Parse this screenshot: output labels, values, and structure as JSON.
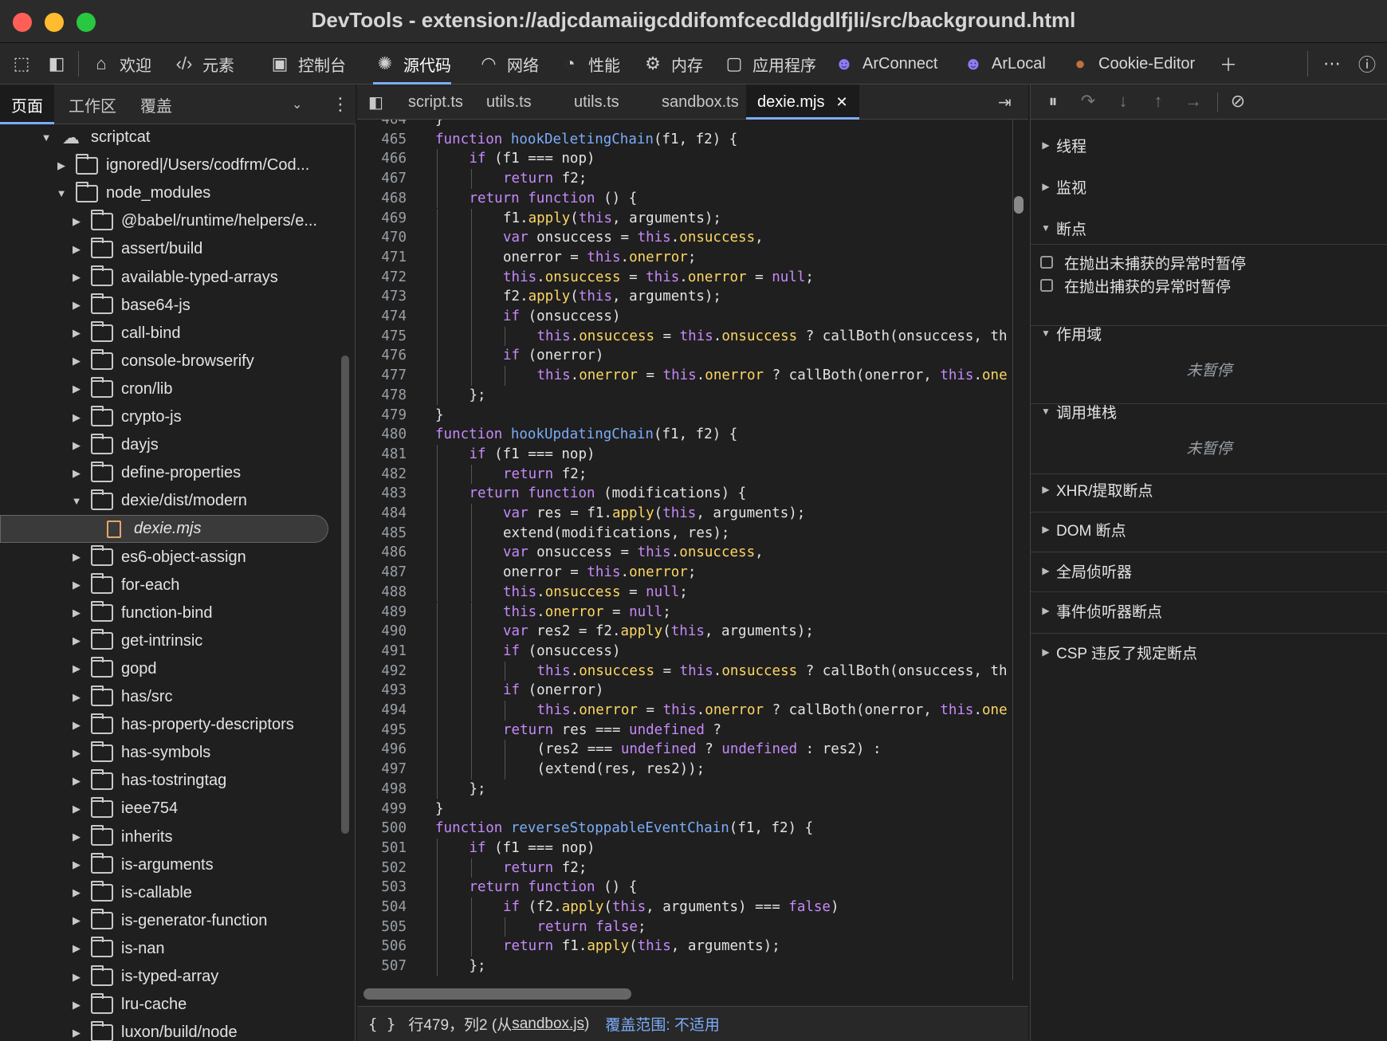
{
  "window": {
    "title": "DevTools - extension://adjcdamaiigcddifomfcecdldgdlfjli/src/background.html"
  },
  "main_tabs": [
    {
      "label": "欢迎",
      "icon": "home-icon"
    },
    {
      "label": "元素",
      "icon": "code-icon"
    },
    {
      "label": "控制台",
      "icon": "console-icon"
    },
    {
      "label": "源代码",
      "icon": "sources-bug-icon"
    },
    {
      "label": "网络",
      "icon": "wifi-icon"
    },
    {
      "label": "性能",
      "icon": "performance-icon"
    },
    {
      "label": "内存",
      "icon": "memory-chip-icon"
    },
    {
      "label": "应用程序",
      "icon": "application-icon"
    },
    {
      "label": "ArConnect",
      "icon": "arconnect-icon"
    },
    {
      "label": "ArLocal",
      "icon": "arlocal-icon"
    },
    {
      "label": "Cookie-Editor",
      "icon": "cookie-icon"
    }
  ],
  "navigator": {
    "tabs": [
      "页面",
      "工作区",
      "覆盖"
    ],
    "tree": [
      {
        "label": "scriptcat",
        "kind": "cloud",
        "depth": 0,
        "expanded": true
      },
      {
        "label": "ignored|/Users/codfrm/Cod...",
        "kind": "folder",
        "depth": 1,
        "expanded": false
      },
      {
        "label": "node_modules",
        "kind": "folder",
        "depth": 1,
        "expanded": true
      },
      {
        "label": "@babel/runtime/helpers/e...",
        "kind": "folder",
        "depth": 2,
        "expanded": false
      },
      {
        "label": "assert/build",
        "kind": "folder",
        "depth": 2,
        "expanded": false
      },
      {
        "label": "available-typed-arrays",
        "kind": "folder",
        "depth": 2,
        "expanded": false
      },
      {
        "label": "base64-js",
        "kind": "folder",
        "depth": 2,
        "expanded": false
      },
      {
        "label": "call-bind",
        "kind": "folder",
        "depth": 2,
        "expanded": false
      },
      {
        "label": "console-browserify",
        "kind": "folder",
        "depth": 2,
        "expanded": false
      },
      {
        "label": "cron/lib",
        "kind": "folder",
        "depth": 2,
        "expanded": false
      },
      {
        "label": "crypto-js",
        "kind": "folder",
        "depth": 2,
        "expanded": false
      },
      {
        "label": "dayjs",
        "kind": "folder",
        "depth": 2,
        "expanded": false
      },
      {
        "label": "define-properties",
        "kind": "folder",
        "depth": 2,
        "expanded": false
      },
      {
        "label": "dexie/dist/modern",
        "kind": "folder",
        "depth": 2,
        "expanded": true
      },
      {
        "label": "dexie.mjs",
        "kind": "file",
        "depth": 3,
        "selected": true
      },
      {
        "label": "es6-object-assign",
        "kind": "folder",
        "depth": 2,
        "expanded": false
      },
      {
        "label": "for-each",
        "kind": "folder",
        "depth": 2,
        "expanded": false
      },
      {
        "label": "function-bind",
        "kind": "folder",
        "depth": 2,
        "expanded": false
      },
      {
        "label": "get-intrinsic",
        "kind": "folder",
        "depth": 2,
        "expanded": false
      },
      {
        "label": "gopd",
        "kind": "folder",
        "depth": 2,
        "expanded": false
      },
      {
        "label": "has/src",
        "kind": "folder",
        "depth": 2,
        "expanded": false
      },
      {
        "label": "has-property-descriptors",
        "kind": "folder",
        "depth": 2,
        "expanded": false
      },
      {
        "label": "has-symbols",
        "kind": "folder",
        "depth": 2,
        "expanded": false
      },
      {
        "label": "has-tostringtag",
        "kind": "folder",
        "depth": 2,
        "expanded": false
      },
      {
        "label": "ieee754",
        "kind": "folder",
        "depth": 2,
        "expanded": false
      },
      {
        "label": "inherits",
        "kind": "folder",
        "depth": 2,
        "expanded": false
      },
      {
        "label": "is-arguments",
        "kind": "folder",
        "depth": 2,
        "expanded": false
      },
      {
        "label": "is-callable",
        "kind": "folder",
        "depth": 2,
        "expanded": false
      },
      {
        "label": "is-generator-function",
        "kind": "folder",
        "depth": 2,
        "expanded": false
      },
      {
        "label": "is-nan",
        "kind": "folder",
        "depth": 2,
        "expanded": false
      },
      {
        "label": "is-typed-array",
        "kind": "folder",
        "depth": 2,
        "expanded": false
      },
      {
        "label": "lru-cache",
        "kind": "folder",
        "depth": 2,
        "expanded": false
      },
      {
        "label": "luxon/build/node",
        "kind": "folder",
        "depth": 2,
        "expanded": false
      }
    ]
  },
  "editor": {
    "tabs": [
      {
        "label": "script.ts",
        "active": false
      },
      {
        "label": "utils.ts",
        "active": false
      },
      {
        "label": "utils.ts",
        "active": false
      },
      {
        "label": "sandbox.ts",
        "active": false
      },
      {
        "label": "dexie.mjs",
        "active": true
      }
    ],
    "lines": [
      {
        "n": "464",
        "t": "}",
        "i": 0
      },
      {
        "n": "465",
        "t": "function hookDeletingChain(f1, f2) {",
        "i": 0
      },
      {
        "n": "466",
        "t": "if (f1 === nop)",
        "i": 1
      },
      {
        "n": "467",
        "t": "return f2;",
        "i": 2
      },
      {
        "n": "468",
        "t": "return function () {",
        "i": 1
      },
      {
        "n": "469",
        "t": "f1.apply(this, arguments);",
        "i": 2
      },
      {
        "n": "470",
        "t": "var onsuccess = this.onsuccess,",
        "i": 2
      },
      {
        "n": "471",
        "t": "onerror = this.onerror;",
        "i": 2
      },
      {
        "n": "472",
        "t": "this.onsuccess = this.onerror = null;",
        "i": 2
      },
      {
        "n": "473",
        "t": "f2.apply(this, arguments);",
        "i": 2
      },
      {
        "n": "474",
        "t": "if (onsuccess)",
        "i": 2
      },
      {
        "n": "475",
        "t": "this.onsuccess = this.onsuccess ? callBoth(onsuccess, th",
        "i": 3
      },
      {
        "n": "476",
        "t": "if (onerror)",
        "i": 2
      },
      {
        "n": "477",
        "t": "this.onerror = this.onerror ? callBoth(onerror, this.one",
        "i": 3
      },
      {
        "n": "478",
        "t": "};",
        "i": 1
      },
      {
        "n": "479",
        "t": "}",
        "i": 0
      },
      {
        "n": "480",
        "t": "function hookUpdatingChain(f1, f2) {",
        "i": 0
      },
      {
        "n": "481",
        "t": "if (f1 === nop)",
        "i": 1
      },
      {
        "n": "482",
        "t": "return f2;",
        "i": 2
      },
      {
        "n": "483",
        "t": "return function (modifications) {",
        "i": 1
      },
      {
        "n": "484",
        "t": "var res = f1.apply(this, arguments);",
        "i": 2
      },
      {
        "n": "485",
        "t": "extend(modifications, res);",
        "i": 2
      },
      {
        "n": "486",
        "t": "var onsuccess = this.onsuccess,",
        "i": 2
      },
      {
        "n": "487",
        "t": "onerror = this.onerror;",
        "i": 2
      },
      {
        "n": "488",
        "t": "this.onsuccess = null;",
        "i": 2
      },
      {
        "n": "489",
        "t": "this.onerror = null;",
        "i": 2
      },
      {
        "n": "490",
        "t": "var res2 = f2.apply(this, arguments);",
        "i": 2
      },
      {
        "n": "491",
        "t": "if (onsuccess)",
        "i": 2
      },
      {
        "n": "492",
        "t": "this.onsuccess = this.onsuccess ? callBoth(onsuccess, th",
        "i": 3
      },
      {
        "n": "493",
        "t": "if (onerror)",
        "i": 2
      },
      {
        "n": "494",
        "t": "this.onerror = this.onerror ? callBoth(onerror, this.one",
        "i": 3
      },
      {
        "n": "495",
        "t": "return res === undefined ?",
        "i": 2
      },
      {
        "n": "496",
        "t": "(res2 === undefined ? undefined : res2) :",
        "i": 3
      },
      {
        "n": "497",
        "t": "(extend(res, res2));",
        "i": 3
      },
      {
        "n": "498",
        "t": "};",
        "i": 1
      },
      {
        "n": "499",
        "t": "}",
        "i": 0
      },
      {
        "n": "500",
        "t": "function reverseStoppableEventChain(f1, f2) {",
        "i": 0
      },
      {
        "n": "501",
        "t": "if (f1 === nop)",
        "i": 1
      },
      {
        "n": "502",
        "t": "return f2;",
        "i": 2
      },
      {
        "n": "503",
        "t": "return function () {",
        "i": 1
      },
      {
        "n": "504",
        "t": "if (f2.apply(this, arguments) === false)",
        "i": 2
      },
      {
        "n": "505",
        "t": "return false;",
        "i": 3
      },
      {
        "n": "506",
        "t": "return f1.apply(this, arguments);",
        "i": 2
      },
      {
        "n": "507",
        "t": "};",
        "i": 1
      }
    ]
  },
  "status": {
    "format_icon": "{ }",
    "position": "行479，列2 (从",
    "source_link": "sandbox.js",
    "position_end": ")",
    "coverage": "覆盖范围: 不适用"
  },
  "debugger": {
    "sections": [
      {
        "label": "线程",
        "expanded": false
      },
      {
        "label": "监视",
        "expanded": false
      },
      {
        "label": "断点",
        "expanded": true
      },
      {
        "label": "作用域",
        "expanded": true
      },
      {
        "label": "调用堆栈",
        "expanded": true
      },
      {
        "label": "XHR/提取断点",
        "expanded": false
      },
      {
        "label": "DOM 断点",
        "expanded": false
      },
      {
        "label": "全局侦听器",
        "expanded": false
      },
      {
        "label": "事件侦听器断点",
        "expanded": false
      },
      {
        "label": "CSP 违反了规定断点",
        "expanded": false
      }
    ],
    "checkboxes": [
      "在抛出未捕获的异常时暂停",
      "在抛出捕获的异常时暂停"
    ],
    "not_paused": "未暂停"
  },
  "colors": {
    "accent": "#7cacf8",
    "keyword": "#c58af9",
    "function": "#7cacf8",
    "property": "#fdd663",
    "close": "#ff5f57",
    "minimize": "#febc2e",
    "zoom": "#28c840"
  }
}
